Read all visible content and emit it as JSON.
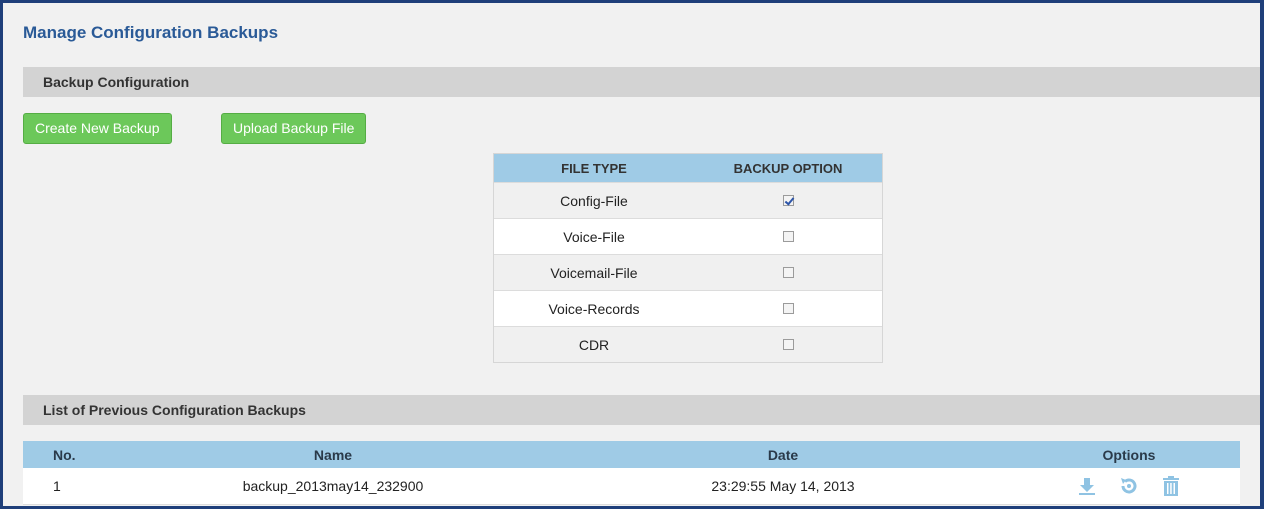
{
  "page": {
    "title": "Manage Configuration Backups"
  },
  "backup_section": {
    "heading": "Backup Configuration",
    "create_button": "Create New Backup",
    "upload_button": "Upload Backup File"
  },
  "backup_table": {
    "headers": {
      "file_type": "FILE TYPE",
      "backup_option": "BACKUP OPTION"
    },
    "rows": [
      {
        "type": "Config-File",
        "checked": true
      },
      {
        "type": "Voice-File",
        "checked": false
      },
      {
        "type": "Voicemail-File",
        "checked": false
      },
      {
        "type": "Voice-Records",
        "checked": false
      },
      {
        "type": "CDR",
        "checked": false
      }
    ]
  },
  "list_section": {
    "heading": "List of Previous Configuration Backups",
    "headers": {
      "no": "No.",
      "name": "Name",
      "date": "Date",
      "options": "Options"
    },
    "rows": [
      {
        "no": "1",
        "name": "backup_2013may14_232900",
        "date": "23:29:55 May 14, 2013",
        "icons": [
          "download-icon",
          "restore-icon",
          "delete-icon"
        ]
      }
    ]
  },
  "colors": {
    "accent": "#6cc85a",
    "title": "#2a5a97",
    "header_bg": "#9fcbe6",
    "icon": "#8fc3e3"
  }
}
